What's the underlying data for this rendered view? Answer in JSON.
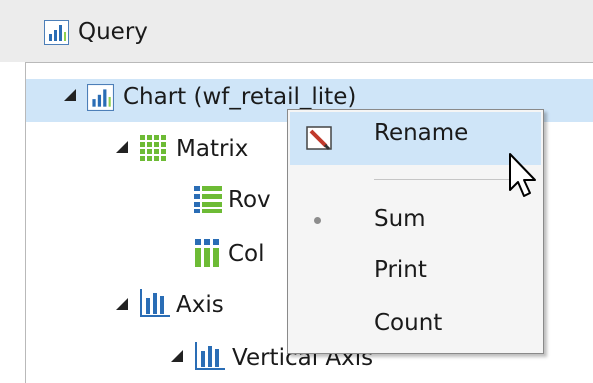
{
  "header": {
    "title": "Query",
    "icon": "bar-chart-icon"
  },
  "tree": {
    "chart": {
      "label": "Chart (wf_retail_lite)",
      "icon": "bar-chart-icon"
    },
    "matrix": {
      "label": "Matrix",
      "icon": "matrix-grid-icon"
    },
    "rows": {
      "label": "Rov",
      "icon": "rows-icon"
    },
    "columns": {
      "label": "Col",
      "icon": "columns-icon"
    },
    "axis": {
      "label": "Axis",
      "icon": "axis-chart-icon"
    },
    "vertical_axis": {
      "label": "Vertical Axis",
      "icon": "axis-chart-icon"
    }
  },
  "context_menu": {
    "rename": {
      "label": "Rename",
      "icon": "rename-icon"
    },
    "sum": {
      "label": "Sum",
      "checked": true
    },
    "print": {
      "label": "Print"
    },
    "count": {
      "label": "Count"
    }
  },
  "colors": {
    "selection": "#cfe5f8",
    "chart_blue": "#2a6db5",
    "grid_green": "#6dbb35"
  }
}
